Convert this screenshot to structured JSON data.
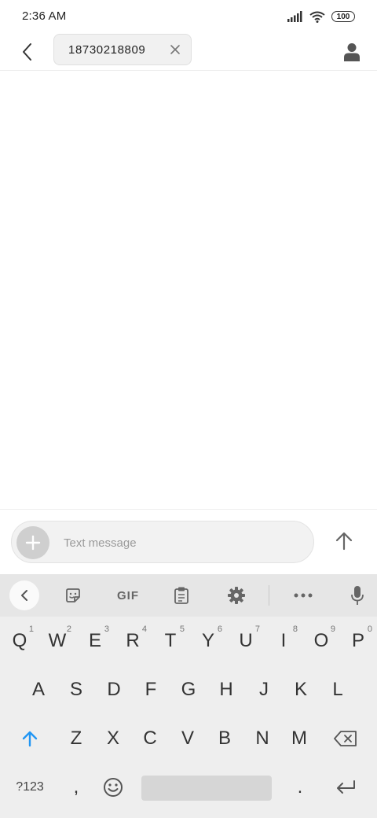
{
  "status_bar": {
    "time": "2:36 AM",
    "battery_level": "100"
  },
  "header": {
    "recipient": "18730218809",
    "icons": {
      "back": "chevron-left-icon",
      "remove": "close-icon",
      "contact": "person-icon"
    }
  },
  "composer": {
    "placeholder": "Text message",
    "value": "",
    "icons": {
      "attach": "plus-icon",
      "send": "arrow-up-icon"
    }
  },
  "keyboard": {
    "toolbar": {
      "gif_label": "GIF",
      "icons": [
        "chevron-left-icon",
        "sticker-icon",
        "gif-icon",
        "clipboard-icon",
        "gear-icon",
        "more-icon",
        "microphone-icon"
      ]
    },
    "row1": [
      {
        "key": "Q",
        "hint": "1"
      },
      {
        "key": "W",
        "hint": "2"
      },
      {
        "key": "E",
        "hint": "3"
      },
      {
        "key": "R",
        "hint": "4"
      },
      {
        "key": "T",
        "hint": "5"
      },
      {
        "key": "Y",
        "hint": "6"
      },
      {
        "key": "U",
        "hint": "7"
      },
      {
        "key": "I",
        "hint": "8"
      },
      {
        "key": "O",
        "hint": "9"
      },
      {
        "key": "P",
        "hint": "0"
      }
    ],
    "row2": [
      "A",
      "S",
      "D",
      "F",
      "G",
      "H",
      "J",
      "K",
      "L"
    ],
    "row3": [
      "Z",
      "X",
      "C",
      "V",
      "B",
      "N",
      "M"
    ],
    "row4": {
      "symbols_label": "?123",
      "comma": ",",
      "period": "."
    },
    "colors": {
      "shift_accent": "#2196f3"
    }
  }
}
